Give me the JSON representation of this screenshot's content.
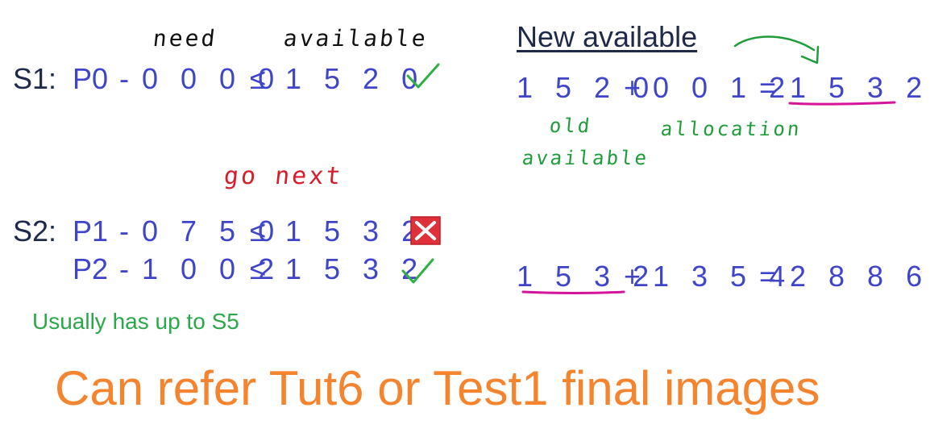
{
  "headers": {
    "need": "need",
    "available": "available"
  },
  "s1": {
    "label": "S1:",
    "process": "P0",
    "dash": "-",
    "need": "0 0 0 0",
    "leq": "≤",
    "available": "1 5 2 0",
    "result_icon": "check-icon"
  },
  "go_next": "go next",
  "s2": {
    "label": "S2:",
    "rows": [
      {
        "process": "P1",
        "dash": "-",
        "need": "0 7 5 0",
        "leq": "≤",
        "available": "1 5 3 2",
        "result_icon": "cross-icon"
      },
      {
        "process": "P2",
        "dash": "-",
        "need": "1 0 0 2",
        "leq": "≤",
        "available": "1 5 3 2",
        "result_icon": "check-icon"
      }
    ]
  },
  "note": "Usually has up to S5",
  "new_available": {
    "title": "New available",
    "eq1": {
      "old": "1 5 2 0",
      "plus": "+",
      "allocation": "0 0 1 2",
      "equals": "=",
      "result": "1 5 3 2"
    },
    "annotations": {
      "old_line1": "old",
      "old_line2": "available",
      "allocation": "allocation"
    },
    "eq2": {
      "old": "1 5 3 2",
      "plus": "+",
      "allocation": "1 3 5 4",
      "equals": "=",
      "result": "2 8 8 6"
    }
  },
  "footer": "Can refer Tut6 or Test1 final images",
  "colors": {
    "dark_text": "#1f2a4a",
    "blue_text": "#3f45c9",
    "check_green": "#2fae45",
    "cross_red": "#e0303a",
    "underline_magenta": "#d4149a",
    "hand_green": "#1f9d3a",
    "hand_red": "#d81d2a",
    "footer_orange": "#f5842f"
  }
}
